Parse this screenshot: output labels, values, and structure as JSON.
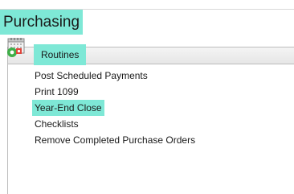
{
  "page": {
    "title": "Purchasing"
  },
  "panel": {
    "header_label": "Routines",
    "icon": "calendar-gear-icon"
  },
  "routines": [
    {
      "label": "Post Scheduled Payments",
      "highlighted": false
    },
    {
      "label": "Print 1099",
      "highlighted": false
    },
    {
      "label": "Year-End Close",
      "highlighted": true
    },
    {
      "label": "Checklists",
      "highlighted": false
    },
    {
      "label": "Remove Completed Purchase Orders",
      "highlighted": false
    }
  ],
  "colors": {
    "highlight": "#7ee8d6",
    "panel_border": "#bdbdbd"
  }
}
